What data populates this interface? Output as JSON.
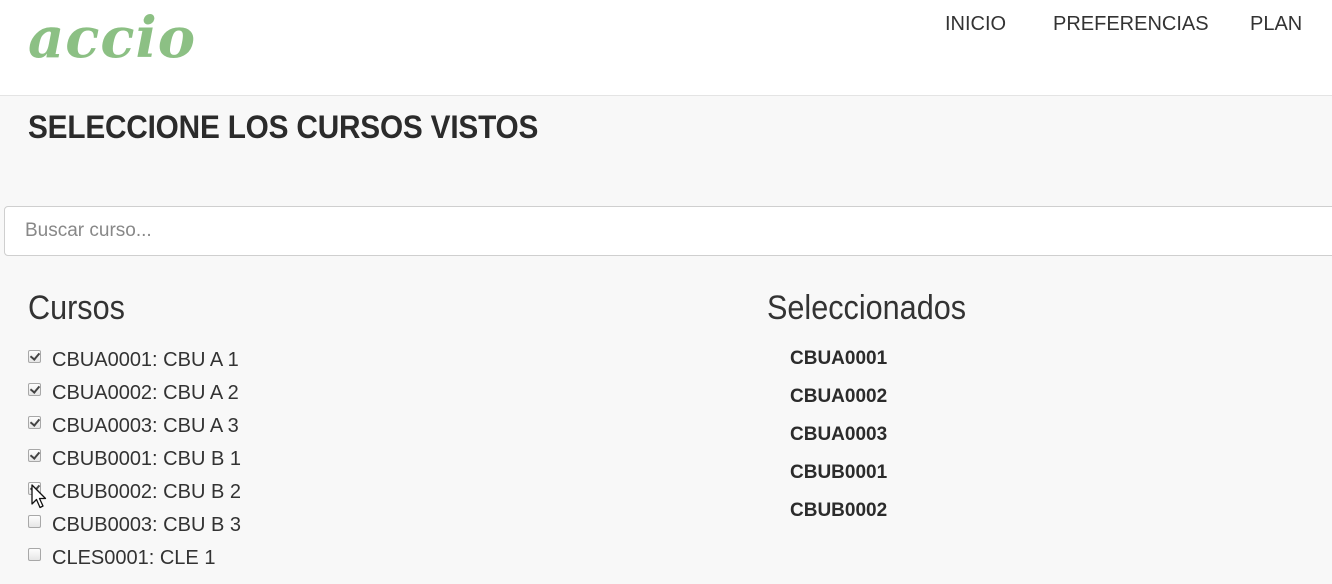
{
  "header": {
    "logo_text": "accio",
    "nav": {
      "inicio": "INICIO",
      "preferencias": "PREFERENCIAS",
      "plan": "PLAN"
    }
  },
  "main": {
    "title": "SELECCIONE LOS CURSOS VISTOS",
    "search": {
      "placeholder": "Buscar curso...",
      "value": ""
    },
    "courses_heading": "Cursos",
    "selected_heading": "Seleccionados",
    "courses": [
      {
        "label": "CBUA0001: CBU A 1",
        "checked": true
      },
      {
        "label": "CBUA0002: CBU A 2",
        "checked": true
      },
      {
        "label": "CBUA0003: CBU A 3",
        "checked": true
      },
      {
        "label": "CBUB0001: CBU B 1",
        "checked": true
      },
      {
        "label": "CBUB0002: CBU B 2",
        "checked": true
      },
      {
        "label": "CBUB0003: CBU B 3",
        "checked": false
      },
      {
        "label": "CLES0001: CLE 1",
        "checked": false
      }
    ],
    "selected": [
      "CBUA0001",
      "CBUA0002",
      "CBUA0003",
      "CBUB0001",
      "CBUB0002"
    ]
  },
  "colors": {
    "logo": "#8cc084",
    "background": "#f8f8f8",
    "navbar": "#ffffff"
  }
}
